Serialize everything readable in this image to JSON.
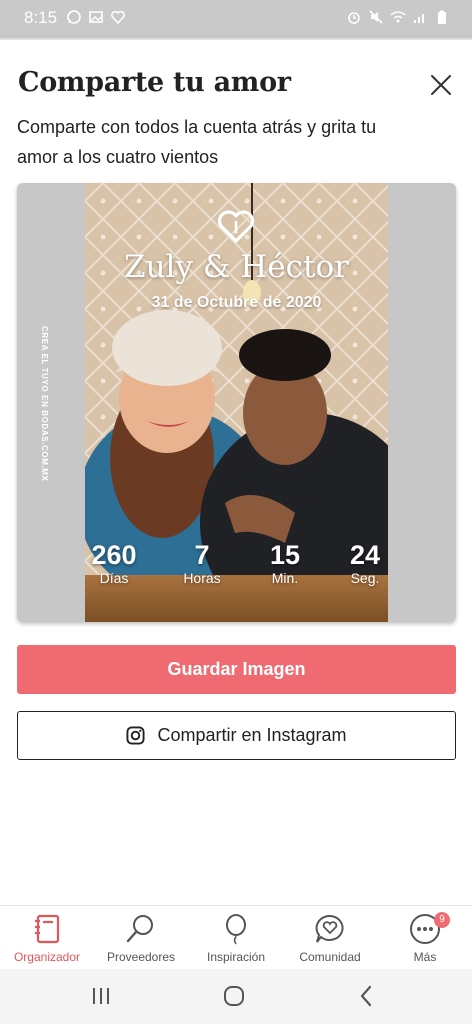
{
  "status_bar": {
    "time": "8:15"
  },
  "sheet": {
    "title": "Comparte tu amor",
    "subtitle": "Comparte con todos la cuenta atrás y grita tu amor a los cuatro vientos"
  },
  "card": {
    "side_text": "CREA EL TUYO EN BODAS.COM.MX",
    "couple_name": "Zuly & Héctor",
    "date": "31 de Octubre de 2020",
    "countdown": [
      {
        "value": "260",
        "unit": "Días"
      },
      {
        "value": "7",
        "unit": "Horas"
      },
      {
        "value": "15",
        "unit": "Min."
      },
      {
        "value": "24",
        "unit": "Seg."
      }
    ]
  },
  "buttons": {
    "save_label": "Guardar Imagen",
    "instagram_label": "Compartir en Instagram"
  },
  "bottom_nav": {
    "items": [
      {
        "label": "Organizador",
        "icon": "notebook-icon",
        "active": true
      },
      {
        "label": "Proveedores",
        "icon": "search-icon",
        "active": false
      },
      {
        "label": "Inspiración",
        "icon": "balloon-icon",
        "active": false
      },
      {
        "label": "Comunidad",
        "icon": "chat-heart-icon",
        "active": false
      },
      {
        "label": "Más",
        "icon": "more-icon",
        "active": false,
        "badge": "9"
      }
    ]
  },
  "colors": {
    "accent": "#f06b71",
    "active_label": "#e3565c",
    "status_bar": "#c9c9c9",
    "card_bg": "#c7c7c7"
  }
}
